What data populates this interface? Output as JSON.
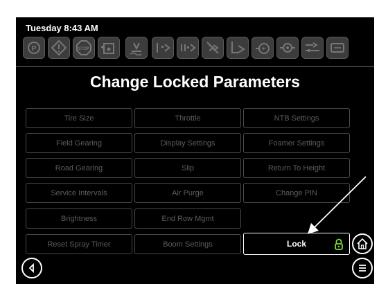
{
  "status": {
    "datetime": "Tuesday 8:43 AM"
  },
  "page": {
    "title": "Change Locked Parameters"
  },
  "header_icons": [
    "parking-brake-icon",
    "warning-icon",
    "stop-icon",
    "tank-icon",
    "spray-icon",
    "boom-left-icon",
    "boom-center-icon",
    "boom-off-icon",
    "boom-right-icon",
    "pump-icon",
    "foam-icon",
    "hydraulic-icon",
    "console-icon"
  ],
  "parameters": {
    "col1": [
      "Tire Size",
      "Field Gearing",
      "Road Gearing",
      "Service Intervals",
      "Brightness",
      "Reset Spray Timer"
    ],
    "col2": [
      "Throttle",
      "Display Settings",
      "Slip",
      "Air Purge",
      "End Row Mgmt",
      "Boom Settings"
    ],
    "col3": [
      "NTB Settings",
      "Foamer Settings",
      "Return To Height",
      "Change PIN"
    ]
  },
  "lock": {
    "label": "Lock",
    "icon": "padlock-icon",
    "icon_color": "#7bdc3a"
  },
  "nav": {
    "home": "home-icon",
    "back": "back-icon",
    "menu": "menu-icon"
  }
}
